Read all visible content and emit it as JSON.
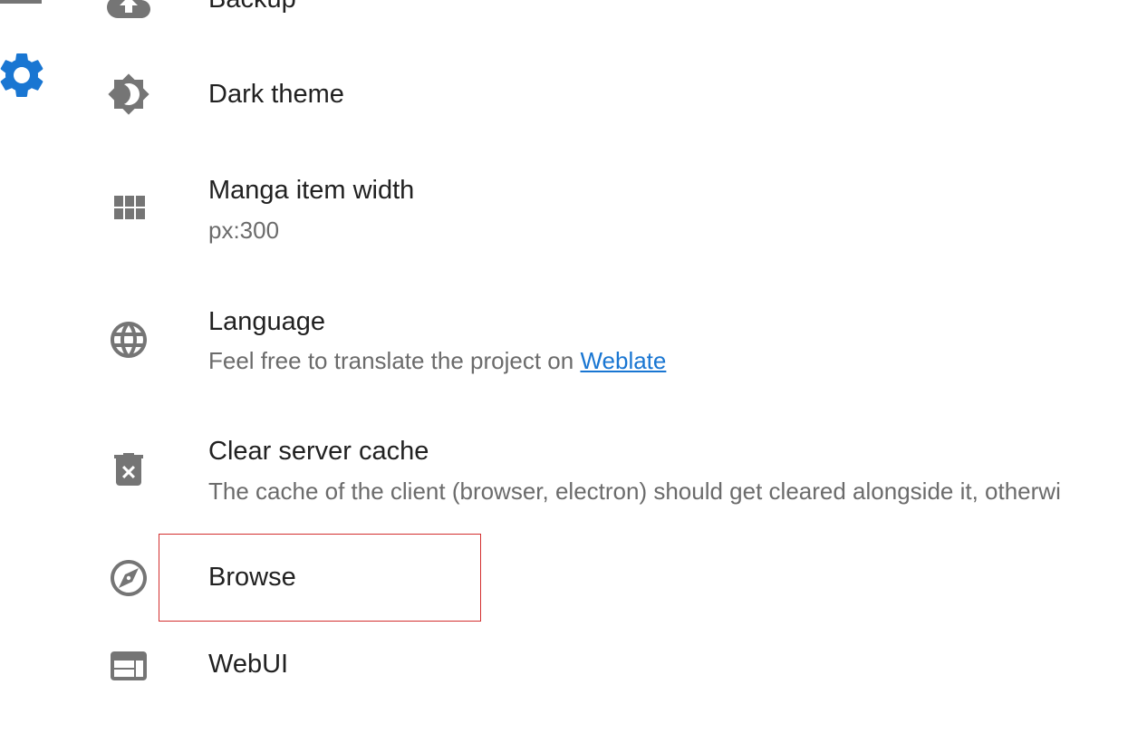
{
  "sidebar": {
    "top_icon": "menu-icon",
    "settings_icon": "gear-icon",
    "settings_icon_color": "#1976d2"
  },
  "settings": {
    "backup": {
      "title": "Backup",
      "icon": "cloud-upload-icon"
    },
    "dark_theme": {
      "title": "Dark theme",
      "icon": "brightness-icon"
    },
    "manga_width": {
      "title": "Manga item width",
      "subtitle": "px:300",
      "icon": "grid-icon"
    },
    "language": {
      "title": "Language",
      "subtitle_prefix": "Feel free to translate the project on ",
      "link_text": "Weblate",
      "icon": "globe-icon"
    },
    "clear_cache": {
      "title": "Clear server cache",
      "subtitle": "The cache of the client (browser, electron) should get cleared alongside it, otherwi",
      "icon": "trash-icon"
    },
    "browse": {
      "title": "Browse",
      "icon": "compass-icon"
    },
    "webui": {
      "title": "WebUI",
      "icon": "web-window-icon"
    }
  },
  "colors": {
    "icon": "#757575",
    "link": "#1976d2",
    "highlight": "#d32f2f"
  }
}
